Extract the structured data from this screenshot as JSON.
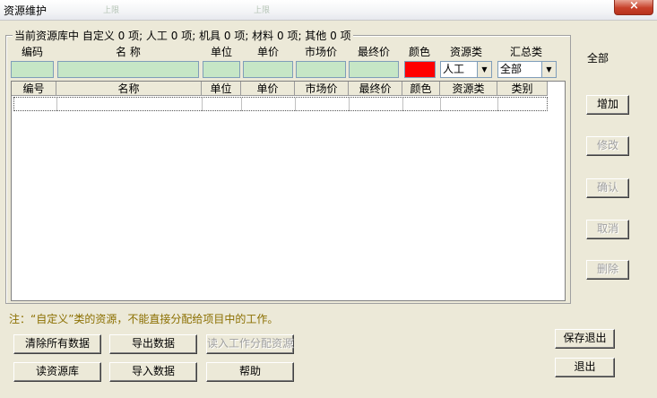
{
  "window": {
    "title": "资源维护",
    "close_label": "×"
  },
  "header_decor": [
    "上限",
    "上限"
  ],
  "summary": "当前资源库中 自定义 0 项; 人工 0 项; 机具 0 项; 材料 0 项; 其他 0 项",
  "editor": {
    "headers": [
      "编码",
      "名    称",
      "单位",
      "单价",
      "市场价",
      "最终价",
      "颜色",
      "资源类",
      "汇总类"
    ],
    "resource_type": "人工",
    "summary_type": "全部",
    "color": "#ff0000"
  },
  "grid": {
    "columns": [
      "编号",
      "名称",
      "单位",
      "单价",
      "市场价",
      "最终价",
      "颜色",
      "资源类",
      "类别"
    ],
    "rows": 1
  },
  "side": {
    "filter_label": "全部",
    "add": "增加",
    "modify": "修改",
    "confirm": "确认",
    "cancel": "取消",
    "delete": "删除"
  },
  "note": "注：“自定义”类的资源，不能直接分配给项目中的工作。",
  "bottom": {
    "clear_all": "清除所有数据",
    "export": "导出数据",
    "import_assign": "读入工作分配资源",
    "read_library": "读资源库",
    "import": "导入数据",
    "help": "帮助",
    "save_exit": "保存退出",
    "exit": "退出"
  }
}
